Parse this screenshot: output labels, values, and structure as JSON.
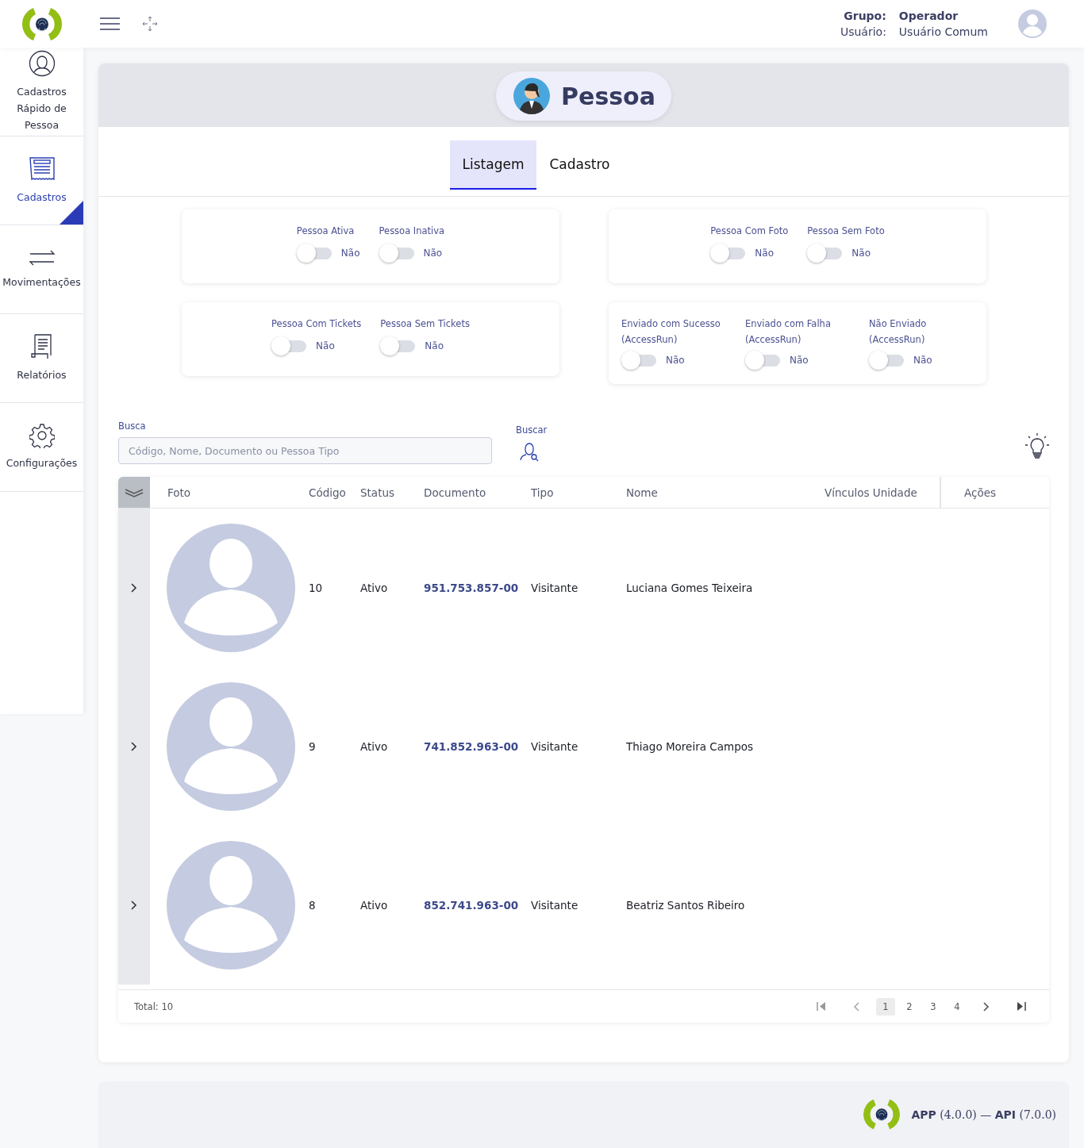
{
  "header": {
    "group_label": "Grupo:",
    "group": "Operador",
    "user_label": "Usuário:",
    "user": "Usuário Comum"
  },
  "sidebar": {
    "items": [
      {
        "kind": "person",
        "label": "Cadastros Rápido de Pessoa",
        "selected": false
      },
      {
        "kind": "receipt",
        "label": "Cadastros",
        "selected": true
      },
      {
        "kind": "arrows",
        "label": "Movimentações",
        "selected": false
      },
      {
        "kind": "report",
        "label": "Relatórios",
        "selected": false
      },
      {
        "kind": "gear",
        "label": "Configurações",
        "selected": false
      }
    ]
  },
  "page_title": "Pessoa",
  "tabs": [
    {
      "label": "Listagem",
      "selected": true
    },
    {
      "label": "Cadastro",
      "selected": false
    }
  ],
  "filter_groups": [
    {
      "filters": [
        {
          "label": "Pessoa Ativa",
          "value": "Não",
          "on": false
        },
        {
          "label": "Pessoa Inativa",
          "value": "Não",
          "on": false
        }
      ]
    },
    {
      "filters": [
        {
          "label": "Pessoa Com Foto",
          "value": "Não",
          "on": false
        },
        {
          "label": "Pessoa Sem Foto",
          "value": "Não",
          "on": false
        }
      ]
    },
    {
      "filters": [
        {
          "label": "Pessoa Com Tickets",
          "value": "Não",
          "on": false
        },
        {
          "label": "Pessoa Sem Tickets",
          "value": "Não",
          "on": false
        }
      ]
    },
    {
      "filters": [
        {
          "label": "Enviado com Sucesso (AccessRun)",
          "value": "Não",
          "on": false
        },
        {
          "label": "Enviado com Falha (AccessRun)",
          "value": "Não",
          "on": false
        },
        {
          "label": "Não Enviado (AccessRun)",
          "value": "Não",
          "on": false
        }
      ]
    }
  ],
  "search": {
    "label": "Busca",
    "placeholder": "Código, Nome, Documento ou Pessoa Tipo",
    "button_label": "Buscar"
  },
  "table": {
    "columns": [
      "Foto",
      "Código",
      "Status",
      "Documento",
      "Tipo",
      "Nome",
      "Vínculos Unidade",
      "Ações"
    ],
    "rows": [
      {
        "code": "10",
        "status": "Ativo",
        "document": "951.753.857-00",
        "type": "Visitante",
        "name": "Luciana Gomes Teixeira",
        "expanded": false
      },
      {
        "code": "9",
        "status": "Ativo",
        "document": "741.852.963-00",
        "type": "Visitante",
        "name": "Thiago Moreira Campos",
        "expanded": false
      },
      {
        "code": "8",
        "status": "Ativo",
        "document": "852.741.963-00",
        "type": "Visitante",
        "name": "Beatriz Santos Ribeiro",
        "expanded": false
      }
    ],
    "total": "Total: 10",
    "pages": [
      {
        "label": "1",
        "selected": true
      },
      {
        "label": "2",
        "selected": false
      },
      {
        "label": "3",
        "selected": false
      },
      {
        "label": "4",
        "selected": false
      }
    ]
  },
  "footer": {
    "version": "**APP** (4.0.0) — **API** (7.0.0)"
  }
}
